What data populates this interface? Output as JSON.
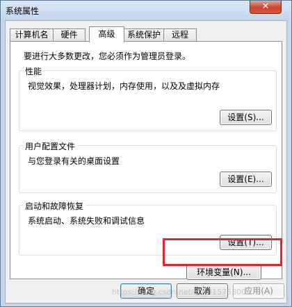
{
  "window": {
    "title": "系统属性",
    "close_label": "✕"
  },
  "tabs": [
    {
      "label": "计算机名",
      "active": false
    },
    {
      "label": "硬件",
      "active": false
    },
    {
      "label": "高级",
      "active": true
    },
    {
      "label": "系统保护",
      "active": false
    },
    {
      "label": "远程",
      "active": false
    }
  ],
  "advanced": {
    "admin_notice": "要进行大多数更改，您必须作为管理员登录。",
    "performance": {
      "title": "性能",
      "description": "视觉效果，处理器计划，内存使用，以及及虚拟内存",
      "button": "设置(S)..."
    },
    "user_profiles": {
      "title": "用户配置文件",
      "description": "与您登录有关的桌面设置",
      "button": "设置(E)..."
    },
    "startup_recovery": {
      "title": "启动和故障恢复",
      "description": "系统启动、系统失败和调试信息",
      "button": "设置(T)..."
    },
    "env_vars_button": "环境变量(N)..."
  },
  "footer": {
    "ok": "确定",
    "cancel": "取消",
    "apply": "应用(A)"
  },
  "watermark": "https://blog.csdn.net/qq_41575300",
  "colors": {
    "highlight": "#e0262a",
    "titlebar": "#c4d6ea"
  }
}
